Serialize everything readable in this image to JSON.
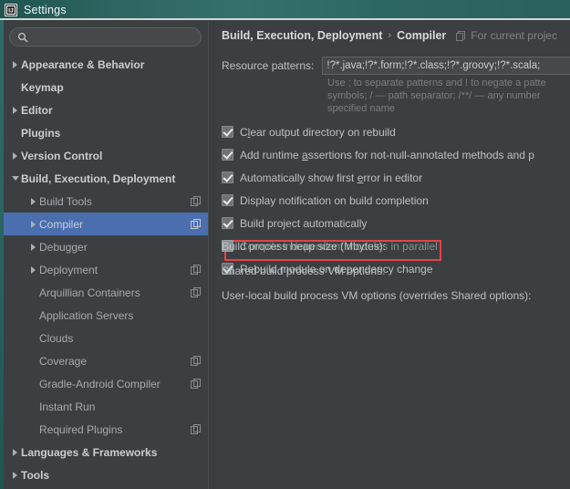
{
  "window": {
    "title": "Settings",
    "logo_text": "IJ"
  },
  "sidebar": {
    "search": {
      "value": "",
      "placeholder": "",
      "icon": "search-icon"
    },
    "items": [
      {
        "label": "Appearance & Behavior",
        "level": 0,
        "arrow": "right",
        "icon": false
      },
      {
        "label": "Keymap",
        "level": 0,
        "arrow": "none",
        "icon": false
      },
      {
        "label": "Editor",
        "level": 0,
        "arrow": "right",
        "icon": false
      },
      {
        "label": "Plugins",
        "level": 0,
        "arrow": "none",
        "icon": false
      },
      {
        "label": "Version Control",
        "level": 0,
        "arrow": "right",
        "icon": false
      },
      {
        "label": "Build, Execution, Deployment",
        "level": 0,
        "arrow": "down",
        "icon": false
      },
      {
        "label": "Build Tools",
        "level": 1,
        "arrow": "right",
        "icon": true
      },
      {
        "label": "Compiler",
        "level": 1,
        "arrow": "right",
        "icon": true,
        "selected": true
      },
      {
        "label": "Debugger",
        "level": 1,
        "arrow": "right",
        "icon": false
      },
      {
        "label": "Deployment",
        "level": 1,
        "arrow": "right",
        "icon": true
      },
      {
        "label": "Arquillian Containers",
        "level": 1,
        "arrow": "none",
        "icon": true
      },
      {
        "label": "Application Servers",
        "level": 1,
        "arrow": "none",
        "icon": false
      },
      {
        "label": "Clouds",
        "level": 1,
        "arrow": "none",
        "icon": false
      },
      {
        "label": "Coverage",
        "level": 1,
        "arrow": "none",
        "icon": true
      },
      {
        "label": "Gradle-Android Compiler",
        "level": 1,
        "arrow": "none",
        "icon": true
      },
      {
        "label": "Instant Run",
        "level": 1,
        "arrow": "none",
        "icon": false
      },
      {
        "label": "Required Plugins",
        "level": 1,
        "arrow": "none",
        "icon": true
      },
      {
        "label": "Languages & Frameworks",
        "level": 0,
        "arrow": "right",
        "icon": false
      },
      {
        "label": "Tools",
        "level": 0,
        "arrow": "right",
        "icon": false
      }
    ]
  },
  "content": {
    "breadcrumb": {
      "root": "Build, Execution, Deployment",
      "separator": "›",
      "leaf": "Compiler",
      "scope_icon": "project-scope-icon",
      "scope_label": "For current projec"
    },
    "resource_patterns": {
      "label": "Resource patterns:",
      "value": "!?*.java;!?*.form;!?*.class;!?*.groovy;!?*.scala;"
    },
    "hint": "Use ; to separate patterns and ! to negate a patte\nsymbols; / — path separator; /**/ — any number\nspecified name",
    "checkboxes": [
      {
        "pre": "C",
        "mn": "l",
        "post": "ear output directory on rebuild",
        "checked": true,
        "enabled": true
      },
      {
        "pre": "Add runtime ",
        "mn": "a",
        "post": "ssertions for not-null-annotated methods and p",
        "checked": true,
        "enabled": true
      },
      {
        "pre": "Automatically show first ",
        "mn": "e",
        "post": "rror in editor",
        "checked": true,
        "enabled": true
      },
      {
        "pre": "Display notification on build completion",
        "mn": "",
        "post": "",
        "checked": true,
        "enabled": true
      },
      {
        "pre": "Build project automatically",
        "mn": "",
        "post": "",
        "checked": true,
        "enabled": true,
        "highlighted": true
      },
      {
        "pre": "Compile independent modules in parallel",
        "mn": "",
        "post": "",
        "checked": false,
        "enabled": false
      },
      {
        "pre": "Rebuild module on dependency change",
        "mn": "",
        "post": "",
        "checked": true,
        "enabled": true
      }
    ],
    "text_rows": [
      {
        "label": "Build process heap size (Mbytes):"
      },
      {
        "label": "Shared build process VM options:"
      },
      {
        "label": "User-local build process VM options (overrides Shared options):"
      }
    ]
  },
  "colors": {
    "titlebar_teal": "#2c6460",
    "panel_bg": "#3c3f41",
    "selection_blue": "#4b6eaf",
    "highlight_red": "#e8424a",
    "text_primary": "#bcc0c3",
    "text_muted": "#797e80"
  }
}
